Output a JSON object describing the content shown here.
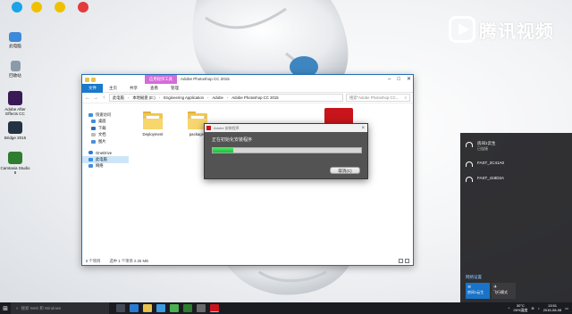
{
  "watermark": {
    "text": "腾讯视频"
  },
  "desktop_icons": [
    {
      "label": "此电脑",
      "color": "#3c8ad8"
    },
    {
      "label": "回收站",
      "color": "#8a9aa8"
    },
    {
      "label": "Adobe After Effects CC",
      "color": "#3a1a56"
    },
    {
      "label": "Bridge 2015",
      "color": "#243244"
    },
    {
      "label": "Camtasia Studio 8",
      "color": "#2f7d2f"
    }
  ],
  "desktop_top_icons": [
    {
      "color": "#1aa3e8"
    },
    {
      "color": "#f0c000"
    },
    {
      "color": "#f0c000"
    },
    {
      "color": "#e33b3b"
    }
  ],
  "explorer": {
    "context_tab": "应用程序工具",
    "title": "Adobe Photoshop CC 2015",
    "ribbon_tabs": [
      "文件",
      "主页",
      "共享",
      "查看",
      "管理"
    ],
    "address": [
      "此电脑",
      "本地磁盘 (E:)",
      "Engineering Application",
      "Adobe",
      "Adobe Photoshop CC 2015"
    ],
    "search_placeholder": "搜索\"Adobe Photoshop CC...",
    "nav": {
      "quick_access": "快速访问",
      "items": [
        "桌面",
        "下载",
        "文档",
        "图片"
      ],
      "onedrive": "OneDrive",
      "this_pc": "此电脑",
      "network": "网络"
    },
    "files": [
      {
        "name": "Deployment"
      },
      {
        "name": "packages"
      }
    ],
    "status": {
      "count": "5 个项目",
      "selected": "选中 1 个项目 2.35 MB"
    }
  },
  "installer": {
    "title": "Adobe 安装程序",
    "message": "正在初始化安装程序",
    "progress": 0.14,
    "cancel_label": "取消(C)"
  },
  "network_flyout": {
    "networks": [
      {
        "name": "房间1云生",
        "status": "已连接"
      },
      {
        "name": "FAST_2C41A0",
        "status": ""
      },
      {
        "name": "FAST_418D2A",
        "status": ""
      }
    ],
    "settings_link": "网络设置",
    "quick_actions": [
      {
        "label": "房间1云生"
      },
      {
        "label": "飞行模式"
      }
    ]
  },
  "taskbar": {
    "search_placeholder": "搜索 Web 和 Windows",
    "weather_temp": "30°C",
    "weather_desc": "26%湿度",
    "time": "13:51",
    "date": "2015-08-08"
  }
}
